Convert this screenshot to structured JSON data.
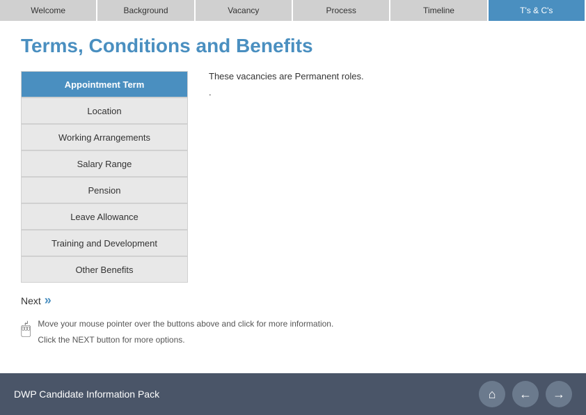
{
  "nav": {
    "tabs": [
      {
        "label": "Welcome",
        "active": false
      },
      {
        "label": "Background",
        "active": false
      },
      {
        "label": "Vacancy",
        "active": false
      },
      {
        "label": "Process",
        "active": false
      },
      {
        "label": "Timeline",
        "active": false
      },
      {
        "label": "T's & C's",
        "active": true
      }
    ]
  },
  "page": {
    "title": "Terms, Conditions and Benefits"
  },
  "sidebar": {
    "items": [
      {
        "label": "Appointment Term",
        "active": true
      },
      {
        "label": "Location",
        "active": false
      },
      {
        "label": "Working Arrangements",
        "active": false
      },
      {
        "label": "Salary Range",
        "active": false
      },
      {
        "label": "Pension",
        "active": false
      },
      {
        "label": "Leave Allowance",
        "active": false
      },
      {
        "label": "Training and Development",
        "active": false
      },
      {
        "label": "Other Benefits",
        "active": false
      }
    ]
  },
  "content": {
    "paragraph1": "These vacancies are Permanent roles.",
    "paragraph2": "."
  },
  "next_button": {
    "label": "Next",
    "arrows": "»"
  },
  "help": {
    "instruction1": "Move your mouse pointer over the buttons above and click for more information.",
    "instruction2": "Click the NEXT button for more options."
  },
  "footer": {
    "title": "DWP Candidate Information Pack",
    "home_icon": "⌂",
    "back_icon": "←",
    "forward_icon": "→"
  }
}
